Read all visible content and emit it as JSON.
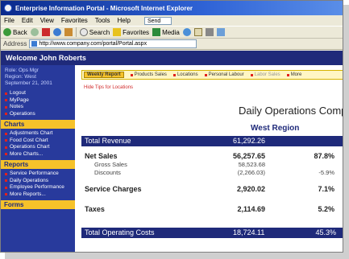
{
  "window": {
    "title": "Enterprise Information Portal - Microsoft Internet Explorer"
  },
  "menubar": {
    "items": [
      "File",
      "Edit",
      "View",
      "Favorites",
      "Tools",
      "Help"
    ],
    "search_box": "Send"
  },
  "toolbar": {
    "back_label": "Back",
    "search_label": "Search",
    "favorites_label": "Favorites",
    "media_label": "Media"
  },
  "addressbar": {
    "label": "Address",
    "url": "http://www.company.com/portal/Portal.aspx"
  },
  "page": {
    "welcome": "Welcome John Roberts",
    "sidebar": {
      "meta_lines": [
        "Role: Ops Mgr",
        "Region: West",
        "September 21, 2001"
      ],
      "top_links": [
        "Logout",
        "MyPage",
        "Notes",
        "Operations"
      ],
      "charts_header": "Charts",
      "chart_links": [
        "Adjustments Chart",
        "Food Cost Chart",
        "Operations Chart",
        "More Charts..."
      ],
      "reports_header": "Reports",
      "report_links": [
        "Service Performance",
        "Daily Operations",
        "Employee Performance",
        "More Reports..."
      ],
      "bottom_header": "Forms"
    },
    "tabs": [
      {
        "label": "Weekly Report",
        "active": true
      },
      {
        "label": "Products Sales",
        "active": false
      },
      {
        "label": "Locations",
        "active": false
      },
      {
        "label": "Personal Labour",
        "active": false
      },
      {
        "label": "Labor Sales",
        "active": false
      },
      {
        "label": "More",
        "active": false
      }
    ],
    "tips_link": "Hide Tips for Locations",
    "report_title": "Daily Operations Comparison",
    "region": "West Region",
    "rows": {
      "total_revenue": {
        "label": "Total Revenue",
        "value": "61,292.26"
      },
      "net_sales": {
        "label": "Net Sales",
        "value": "56,257.65",
        "pct": "87.8%"
      },
      "gross_sales": {
        "label": "Gross Sales",
        "value": "58,523.68"
      },
      "discounts": {
        "label": "Discounts",
        "value": "(2,266.03)",
        "pct": "-5.9%"
      },
      "service_charges": {
        "label": "Service Charges",
        "value": "2,920.02",
        "pct": "7.1%"
      },
      "taxes": {
        "label": "Taxes",
        "value": "2,114.69",
        "pct": "5.2%"
      },
      "total_operating_costs": {
        "label": "Total Operating Costs",
        "value": "18,724.11",
        "pct": "45.3%"
      }
    }
  }
}
